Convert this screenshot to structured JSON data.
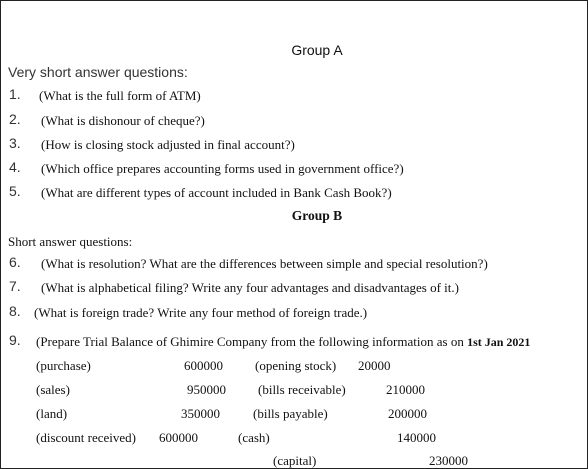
{
  "group_a": {
    "title": "Group A",
    "subtitle": "Very short answer questions:",
    "questions": [
      {
        "num": "1.",
        "text": "(What is the full form of ATM)"
      },
      {
        "num": "2.",
        "text": "(What is dishonour of cheque?)"
      },
      {
        "num": "3.",
        "text": "(How is closing stock adjusted in final account?)"
      },
      {
        "num": "4.",
        "text": "(Which office prepares accounting forms used in government office?)"
      },
      {
        "num": "5.",
        "text": "(What are different types of account included in Bank Cash Book?)"
      }
    ]
  },
  "group_b": {
    "title": "Group B",
    "subtitle": "Short answer questions:",
    "questions": [
      {
        "num": "6.",
        "text": "(What is resolution? What are the differences between simple and special resolution?)"
      },
      {
        "num": "7.",
        "text": "(What is alphabetical filing? Write any four advantages and disadvantages of it.)"
      },
      {
        "num": "8.",
        "text": "(What is foreign trade? Write any four method of foreign trade.)"
      },
      {
        "num": "9.",
        "text": "(Prepare Trial Balance of Ghimire Company from the following information as on ",
        "date": "1st Jan 2021"
      }
    ]
  },
  "trial_balance": [
    {
      "label": "(purchase)",
      "value": "600000"
    },
    {
      "label": "(opening stock)",
      "value": "20000"
    },
    {
      "label": "(sales)",
      "value": "950000"
    },
    {
      "label": "(bills receivable)",
      "value": "210000"
    },
    {
      "label": "(land)",
      "value": "350000"
    },
    {
      "label": "(bills payable)",
      "value": "200000"
    },
    {
      "label": "(discount received)",
      "value": "600000"
    },
    {
      "label": "(cash)",
      "value": "140000"
    },
    {
      "label": "(capital)",
      "value": "230000"
    }
  ]
}
